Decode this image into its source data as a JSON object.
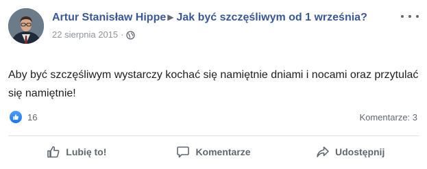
{
  "post": {
    "author": "Artur Stanisław Hippe",
    "separator_icon": "triangle-right-icon",
    "target_title": "Jak być szczęśliwym od 1 września?",
    "date": "22 sierpnia 2015",
    "dot": "·",
    "privacy_icon": "globe-icon",
    "more_icon": "more-dots-icon",
    "text": "Aby być szczęśliwym wystarczy kochać się namiętnie dniami i nocami oraz przytulać się namiętnie!"
  },
  "stats": {
    "like_icon": "thumbs-up-badge-icon",
    "likes": "16",
    "comments": "Komentarze: 3"
  },
  "actions": {
    "like_label": "Lubię to!",
    "comment_label": "Komentarze",
    "share_label": "Udostępnij"
  },
  "colors": {
    "link": "#385898",
    "secondary_text": "#90949c",
    "action_text": "#606770",
    "like_blue": "#1877f2",
    "divider": "#dadde1"
  }
}
